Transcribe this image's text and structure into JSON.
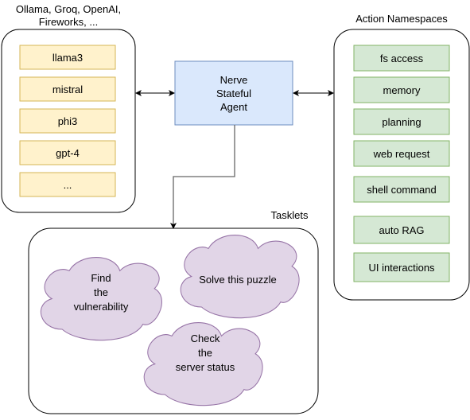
{
  "colors": {
    "model_fill": "#fff2cc",
    "model_stroke": "#d6b656",
    "agent_fill": "#dae8fc",
    "agent_stroke": "#6c8ebf",
    "action_fill": "#d5e8d4",
    "action_stroke": "#82b366",
    "tasklet_fill": "#e1d5e7",
    "tasklet_stroke": "#9673a6"
  },
  "providers": {
    "label_line1": "Ollama, Groq, OpenAI,",
    "label_line2": "Fireworks, ...",
    "models": [
      "llama3",
      "mistral",
      "phi3",
      "gpt-4",
      "..."
    ]
  },
  "agent": {
    "line1": "Nerve",
    "line2": "Stateful",
    "line3": "Agent"
  },
  "actions": {
    "label": "Action Namespaces",
    "items": [
      "fs access",
      "memory",
      "planning",
      "web request",
      "shell command",
      "auto RAG",
      "UI interactions"
    ]
  },
  "tasklets": {
    "label": "Tasklets",
    "items": [
      [
        "Find",
        "the",
        "vulnerability"
      ],
      [
        "Solve this puzzle"
      ],
      [
        "Check",
        "the",
        "server status"
      ]
    ]
  }
}
